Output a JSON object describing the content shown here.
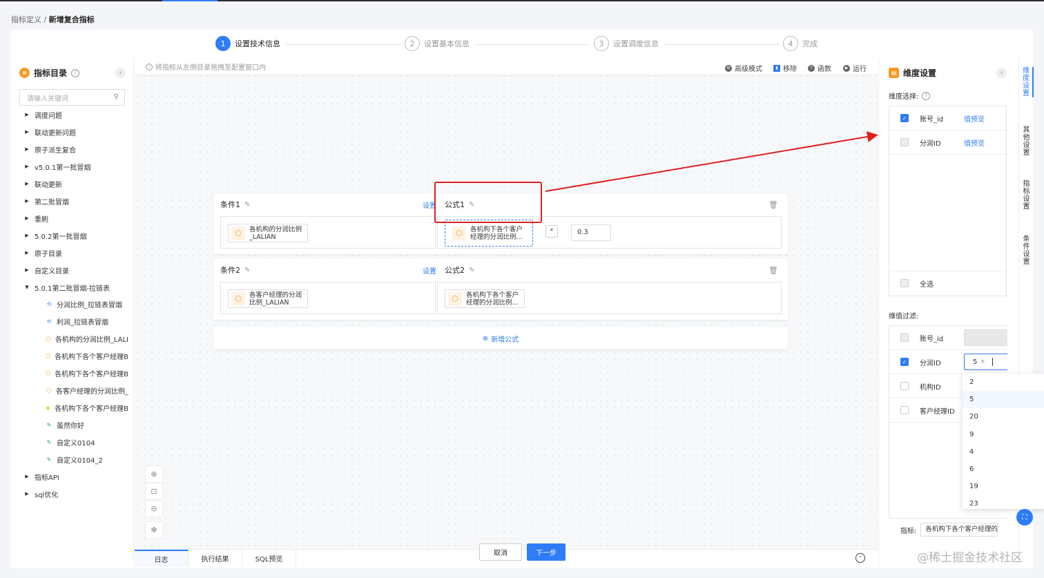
{
  "breadcrumb": {
    "parent": "指标定义",
    "sep": "/",
    "current": "新增复合指标"
  },
  "steps": [
    {
      "num": "1",
      "label": "设置技术信息"
    },
    {
      "num": "2",
      "label": "设置基本信息"
    },
    {
      "num": "3",
      "label": "设置调度信息"
    },
    {
      "num": "4",
      "label": "完成"
    }
  ],
  "sidebar": {
    "title": "指标目录",
    "search_placeholder": "请输入关键词",
    "items": [
      "调度问题",
      "联动更新问题",
      "原子派生复合",
      "v5.0.1第一批冒烟",
      "联动更新",
      "第二批冒烟",
      "重刷",
      "5.0.2第一批冒烟",
      "原子目录",
      "自定义目录",
      "5.0.1第二批冒烟-拉链表"
    ],
    "children": [
      "分润比例_拉链表冒烟",
      "利润_拉链表冒烟",
      "各机构的分润比例_LALI",
      "各机构下各个客户经理B",
      "各机构下各个客户经理B",
      "各客户经理的分润比例_",
      "各机构下各个客户经理B",
      "虽然你好",
      "自定义0104",
      "自定义0104_2"
    ],
    "tail": [
      "指标API",
      "sql优化"
    ]
  },
  "canvas": {
    "hint": "将指标从左侧目录拖拽至配置窗口内",
    "tools": {
      "advanced": "高级模式",
      "remove": "移除",
      "func": "函数",
      "run": "运行"
    },
    "block1": {
      "cond_title": "条件1",
      "set_label": "设置",
      "formula_title": "公式1",
      "cond_chip_l1": "各机构的分润比例",
      "cond_chip_l2": "_LALIAN",
      "formula_chip_l1": "各机构下各个客户",
      "formula_chip_l2": "经理的分润比例...",
      "operator": "*",
      "value": "0.3"
    },
    "block2": {
      "cond_title": "条件2",
      "set_label": "设置",
      "formula_title": "公式2",
      "cond_chip_l1": "各客户经理的分润",
      "cond_chip_l2": "比例_LALIAN",
      "formula_chip_l1": "各机构下各个客户",
      "formula_chip_l2": "经理的分润比例..."
    },
    "add_formula": "新增公式",
    "bottom_tabs": [
      "日志",
      "执行结果",
      "SQL预览"
    ]
  },
  "right_panel": {
    "title": "维度设置",
    "dim_select_label": "维度选择:",
    "dims": [
      {
        "name": "账号_id",
        "checked": true,
        "preview": "值预览"
      },
      {
        "name": "分润ID",
        "checked": false,
        "preview": "值预览"
      }
    ],
    "select_all": "全选",
    "filter_label": "维值过滤:",
    "filters": [
      {
        "name": "账号_id",
        "checked": false
      },
      {
        "name": "分润ID",
        "checked": true,
        "tag": "5"
      },
      {
        "name": "机构ID",
        "checked": false
      },
      {
        "name": "客户经理ID",
        "checked": false
      }
    ],
    "metric_label": "指标:",
    "metric_value": "各机构下各个客户经理的分润比例"
  },
  "side_tabs": [
    "维度设置",
    "其他设置",
    "指标设置",
    "条件设置"
  ],
  "dropdown_options": [
    "2",
    "5",
    "20",
    "9",
    "4",
    "6",
    "19",
    "23"
  ],
  "footer": {
    "cancel": "取消",
    "next": "下一步"
  },
  "watermark": "@稀土掘金技术社区",
  "colors": {
    "primary": "#2e7cf6",
    "accent_orange": "#f59a23",
    "highlight_red": "#e02020"
  }
}
